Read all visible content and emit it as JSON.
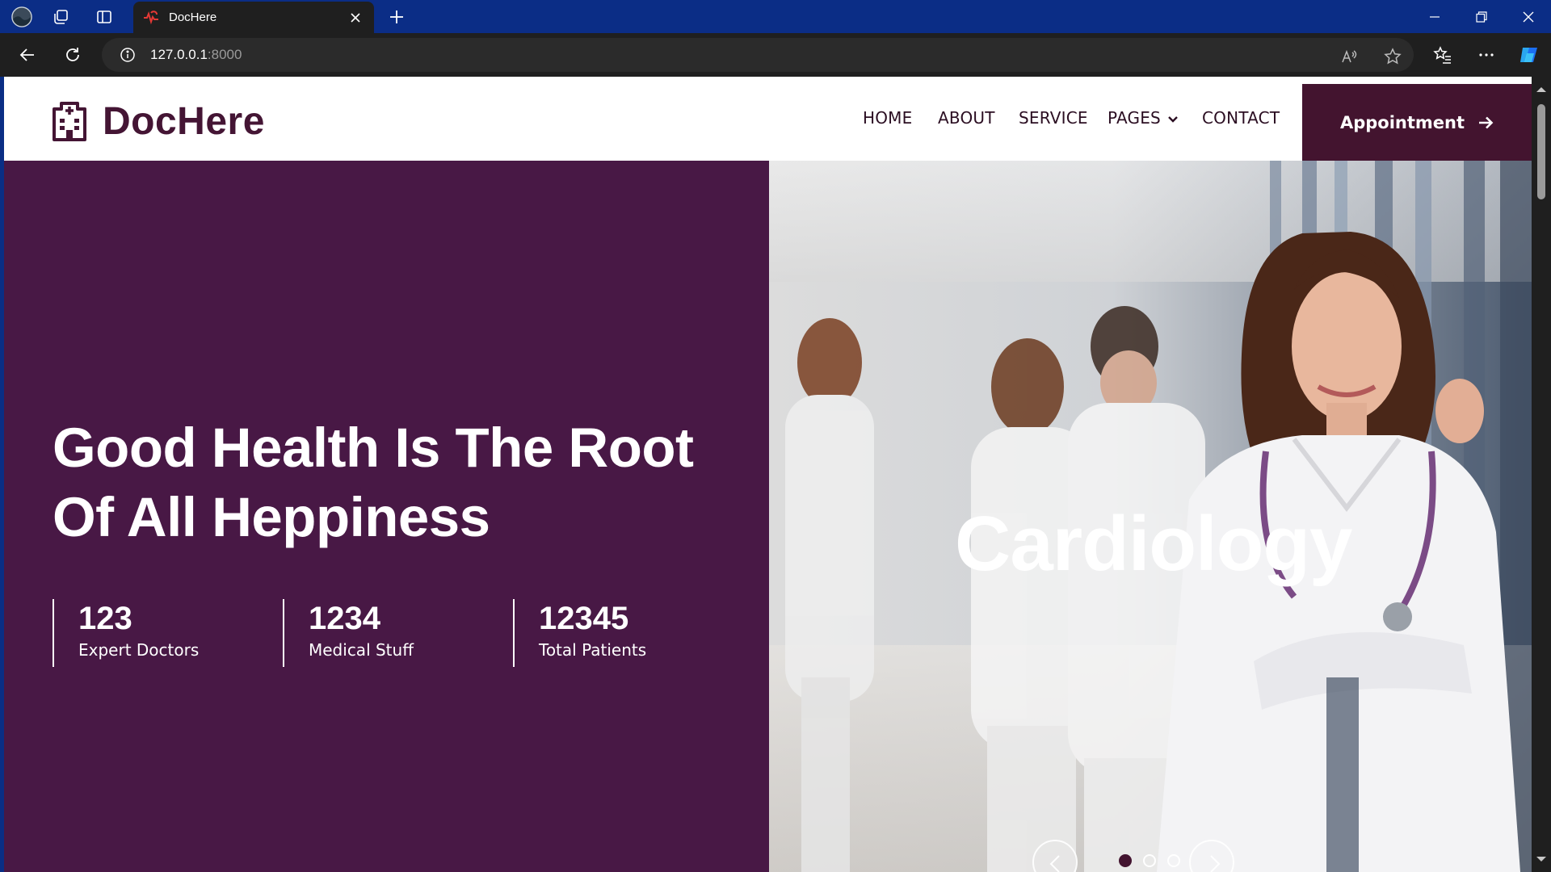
{
  "browser": {
    "tab_title": "DocHere",
    "url_host": "127.0.0.1",
    "url_port": ":8000",
    "accent": "#0b2d86"
  },
  "site": {
    "brand": "DocHere",
    "nav": [
      "HOME",
      "ABOUT",
      "SERVICE",
      "PAGES",
      "CONTACT"
    ],
    "appointment_label": "Appointment",
    "primary_color": "#481845"
  },
  "hero": {
    "headline_line1": "Good Health Is The Root",
    "headline_line2": "Of All Heppiness",
    "slide_title": "Cardiology",
    "stats": [
      {
        "value": "123",
        "label": "Expert Doctors"
      },
      {
        "value": "1234",
        "label": "Medical Stuff"
      },
      {
        "value": "12345",
        "label": "Total Patients"
      }
    ]
  }
}
